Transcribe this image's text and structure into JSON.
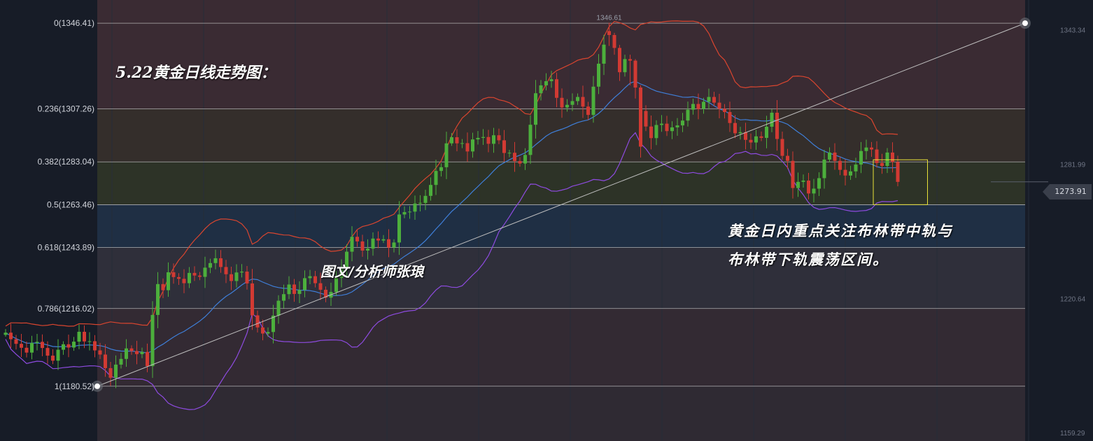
{
  "annotations": {
    "title": "5.22黄金日线走势图：",
    "author": "图文/分析师张琅",
    "note_line1": "黄金日内重点关注布林带中轨与",
    "note_line2": "布林带下轨震荡区间。",
    "high_label": "1346.61",
    "last_price": "1273.91"
  },
  "colors": {
    "background": "#171c27",
    "up_candle": "#4caf3c",
    "down_candle": "#d23a33",
    "boll_upper": "#d9452f",
    "boll_middle": "#3f7fd9",
    "boll_lower": "#8e4be0",
    "trendline": "#bfbfbf",
    "highlight_box": "#e8e23a",
    "fib_line": "#c8c8c8"
  },
  "chart_data": {
    "type": "candlestick",
    "fib_levels": [
      {
        "ratio": "0",
        "price": 1346.41,
        "label": "0(1346.41)"
      },
      {
        "ratio": "0.236",
        "price": 1307.26,
        "label": "0.236(1307.26)"
      },
      {
        "ratio": "0.382",
        "price": 1283.04,
        "label": "0.382(1283.04)"
      },
      {
        "ratio": "0.5",
        "price": 1263.46,
        "label": "0.5(1263.46)"
      },
      {
        "ratio": "0.618",
        "price": 1243.89,
        "label": "0.618(1243.89)"
      },
      {
        "ratio": "0.786",
        "price": 1216.02,
        "label": "0.786(1216.02)"
      },
      {
        "ratio": "1",
        "price": 1180.52,
        "label": "1(1180.52)"
      }
    ],
    "fib_band_colors": [
      "#3a2b33",
      "#342e2b",
      "#2d3327",
      "#1f2f44",
      "#2f2f3a",
      "#332a33",
      "#2f2a33"
    ],
    "right_axis_ticks": [
      1343.34,
      1281.99,
      1220.64,
      1159.29
    ],
    "right_axis_labels": [
      "1343.34",
      "1281.99",
      "1220.64",
      "1159.29"
    ],
    "ylim": [
      1155.5,
      1357.0
    ],
    "trendline": {
      "from": [
        18,
        1180.52
      ],
      "to": [
        181,
        1346.41
      ]
    },
    "highlight_range": {
      "from_index": 166,
      "to_index": 175,
      "price_top": 1284.0,
      "price_bottom": 1263.5
    },
    "closes": [
      1205.0,
      1202.0,
      1199.9,
      1198.1,
      1195.9,
      1200.3,
      1200.8,
      1198.0,
      1194.5,
      1192.2,
      1197.2,
      1199.7,
      1198.2,
      1200.9,
      1205.4,
      1201.0,
      1201.1,
      1196.9,
      1195.0,
      1188.8,
      1184.4,
      1190.4,
      1193.0,
      1197.8,
      1196.6,
      1195.2,
      1196.2,
      1189.7,
      1213.1,
      1227.2,
      1224.4,
      1232.6,
      1230.4,
      1229.6,
      1227.6,
      1232.3,
      1231.1,
      1230.5,
      1234.7,
      1236.8,
      1239.0,
      1235.0,
      1231.7,
      1228.6,
      1232.5,
      1232.9,
      1227.5,
      1212.9,
      1207.4,
      1204.6,
      1205.3,
      1212.8,
      1219.6,
      1222.6,
      1227.0,
      1222.7,
      1224.5,
      1229.9,
      1230.8,
      1227.6,
      1224.6,
      1221.0,
      1223.6,
      1230.0,
      1234.8,
      1242.0,
      1248.8,
      1246.7,
      1242.5,
      1243.4,
      1248.0,
      1247.1,
      1247.7,
      1243.9,
      1246.2,
      1259.0,
      1260.1,
      1260.3,
      1264.0,
      1264.3,
      1267.5,
      1272.5,
      1278.9,
      1280.6,
      1291.5,
      1294.3,
      1291.5,
      1291.6,
      1287.8,
      1293.3,
      1294.0,
      1294.4,
      1291.3,
      1295.2,
      1292.9,
      1287.1,
      1287.2,
      1283.4,
      1282.3,
      1286.2,
      1300.0,
      1314.4,
      1318.0,
      1319.9,
      1320.8,
      1312.3,
      1307.9,
      1309.1,
      1310.8,
      1312.7,
      1308.3,
      1304.5,
      1317.4,
      1327.9,
      1336.6,
      1341.0,
      1335.1,
      1333.4,
      1328.1,
      1329.3,
      1319.5,
      1306.3,
      1299.2,
      1293.9,
      1299.9,
      1300.5,
      1297.1,
      1298.8,
      1299.7,
      1301.9,
      1306.9,
      1309.5,
      1307.2,
      1310.5,
      1312.7,
      1310.1,
      1307.3,
      1305.8,
      1300.8,
      1296.1,
      1296.6,
      1293.1,
      1291.9,
      1294.7,
      1294.0,
      1299.1,
      1305.5,
      1293.5,
      1285.8,
      1283.5,
      1271.1,
      1273.9,
      1274.5,
      1268.6,
      1270.8,
      1275.6,
      1284.1,
      1287.3,
      1283.5,
      1279.4,
      1276.8,
      1278.7,
      1281.8,
      1288.0,
      1289.6,
      1288.7,
      1282.5,
      1281.2,
      1287.3,
      1283.0,
      1273.9
    ],
    "window": [
      {
        "o": 1342.8,
        "h": 1346.6,
        "l": 1336.0,
        "c": 1341.0
      },
      {
        "o": 1341.0,
        "h": 1342.0,
        "l": 1332.0,
        "c": 1335.1
      },
      {
        "o": 1335.1,
        "h": 1336.5,
        "l": 1320.0,
        "c": 1324.0
      },
      {
        "o": 1324.0,
        "h": 1332.0,
        "l": 1322.0,
        "c": 1330.0
      },
      {
        "o": 1330.0,
        "h": 1332.0,
        "l": 1318.0,
        "c": 1329.3
      },
      {
        "o": 1329.3,
        "h": 1330.0,
        "l": 1312.0,
        "c": 1317.0
      },
      {
        "o": 1317.0,
        "h": 1318.0,
        "l": 1285.0,
        "c": 1290.0
      }
    ],
    "last_price": 1273.91,
    "period": 20,
    "width": 2.0
  }
}
